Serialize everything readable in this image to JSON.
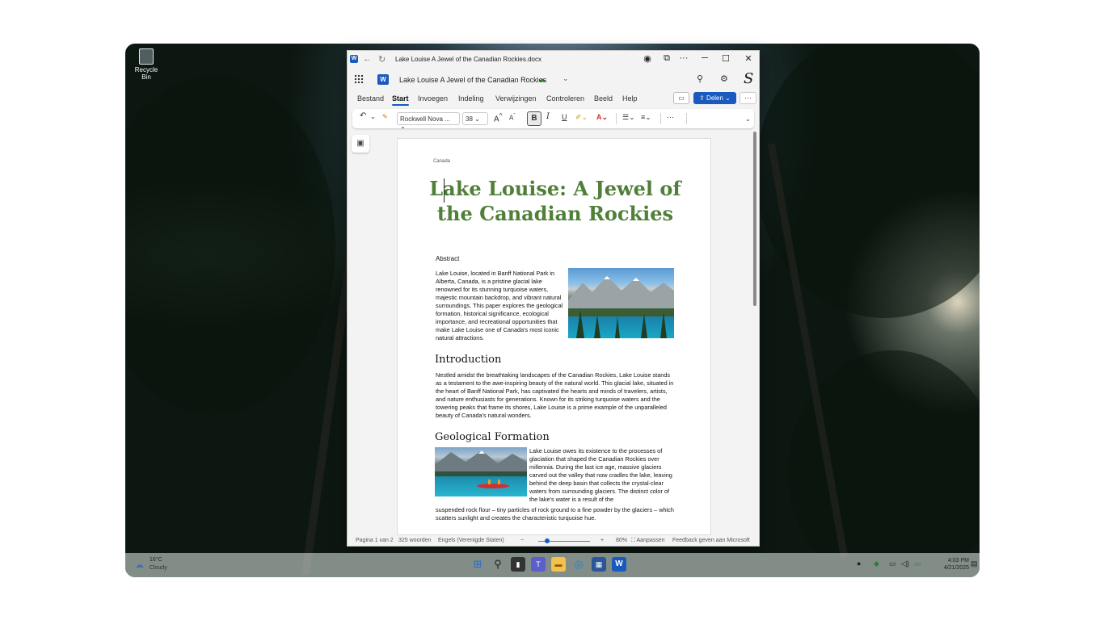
{
  "desktop": {
    "recycle_bin_label": "Recycle Bin"
  },
  "window": {
    "title": "Lake Louise A Jewel of the Canadian Rockies.docx",
    "doc_title": "Lake Louise A Jewel of the Canadian Rockies",
    "controls": {
      "minimize": "─",
      "maximize": "☐",
      "close": "✕",
      "more": "···"
    }
  },
  "ribbon_tabs": [
    "Bestand",
    "Start",
    "Invoegen",
    "Indeling",
    "Verwijzingen",
    "Controleren",
    "Beeld",
    "Help"
  ],
  "share_label": "Delen",
  "toolbar": {
    "font_name": "Rockwell Nova ...",
    "font_size": "38",
    "bold": "B",
    "italic": "I",
    "underline": "U",
    "more": "···"
  },
  "document": {
    "header": "Canada",
    "title": "Lake Louise: A Jewel of the Canadian Rockies",
    "abstract_heading": "Abstract",
    "abstract_text": "Lake Louise, located in Banff National Park in Alberta, Canada, is a pristine glacial lake renowned for its stunning turquoise waters, majestic mountain backdrop, and vibrant natural surroundings. This paper explores the geological formation, historical significance, ecological importance, and recreational opportunities that make Lake Louise one of Canada's most iconic natural attractions.",
    "intro_heading": "Introduction",
    "intro_text": "Nestled amidst the breathtaking landscapes of the Canadian Rockies, Lake Louise stands as a testament to the awe-inspiring beauty of the natural world. This glacial lake, situated in the heart of Banff National Park, has captivated the hearts and minds of travelers, artists, and nature enthusiasts for generations. Known for its striking turquoise waters and the towering peaks that frame its shores, Lake Louise is a prime example of the unparalleled beauty of Canada's natural wonders.",
    "geo_heading": "Geological Formation",
    "geo_text_wrap": "Lake Louise owes its existence to the processes of glaciation that shaped the Canadian Rockies over millennia. During the last ice age, massive glaciers carved out the valley that now cradles the lake, leaving behind the deep basin that collects the crystal-clear waters from surrounding glaciers. The distinct color of the lake's water is a result of the",
    "geo_text_full": "suspended rock flour – tiny particles of rock ground to a fine powder by the glaciers – which scatters sunlight and creates the characteristic turquoise hue."
  },
  "status_bar": {
    "page": "Pagina 1 van 2",
    "words": "325 woorden",
    "language": "Engels (Verenigde Staten)",
    "zoom_out": "−",
    "zoom_in": "+",
    "zoom": "80%",
    "fit": "Aanpassen",
    "feedback": "Feedback geven aan Microsoft"
  },
  "taskbar": {
    "weather_temp": "16°C",
    "weather_condition": "Cloudy",
    "time": "4:03 PM",
    "date": "4/21/2025"
  },
  "icons": [
    "word-icon",
    "back-icon",
    "sync-icon",
    "eye-icon",
    "copilot-icon",
    "search-icon",
    "gear-icon",
    "comment-icon",
    "share-icon",
    "undo-icon",
    "format-painter-icon",
    "nav-pane-icon",
    "windows-start-icon",
    "taskbar-search-icon",
    "edge-icon",
    "word-taskbar-icon"
  ]
}
